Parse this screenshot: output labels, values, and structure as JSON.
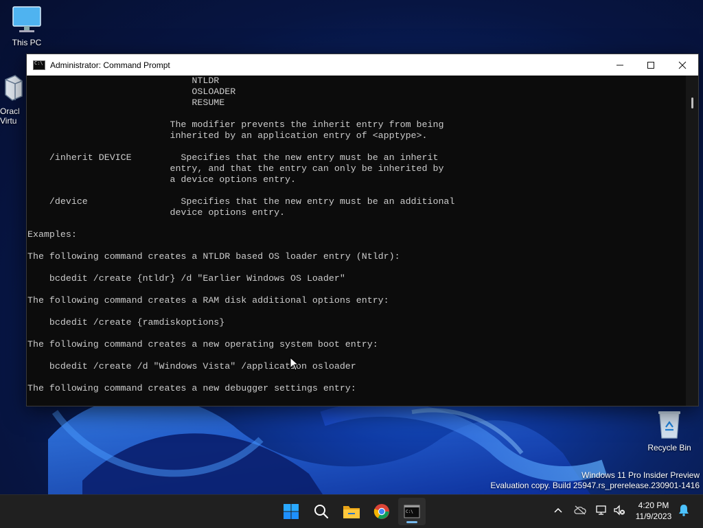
{
  "desktop": {
    "icons": [
      {
        "label": "This PC"
      },
      {
        "label": "Oracl\nVirtu"
      },
      {
        "label": "Recycle Bin"
      }
    ],
    "watermark": {
      "line1": "Windows 11 Pro Insider Preview",
      "line2": "Evaluation copy. Build 25947.rs_prerelease.230901-1416"
    }
  },
  "window": {
    "title": "Administrator: Command Prompt",
    "controls": {
      "minimize": "─",
      "maximize": "☐",
      "close": "✕"
    },
    "console_lines": [
      "                              NTLDR",
      "                              OSLOADER",
      "                              RESUME",
      "",
      "                          The modifier prevents the inherit entry from being",
      "                          inherited by an application entry of <apptype>.",
      "",
      "    /inherit DEVICE         Specifies that the new entry must be an inherit",
      "                          entry, and that the entry can only be inherited by",
      "                          a device options entry.",
      "",
      "    /device                 Specifies that the new entry must be an additional",
      "                          device options entry.",
      "",
      "Examples:",
      "",
      "The following command creates a NTLDR based OS loader entry (Ntldr):",
      "",
      "    bcdedit /create {ntldr} /d \"Earlier Windows OS Loader\"",
      "",
      "The following command creates a RAM disk additional options entry:",
      "",
      "    bcdedit /create {ramdiskoptions}",
      "",
      "The following command creates a new operating system boot entry:",
      "",
      "    bcdedit /create /d \"Windows Vista\" /application osloader",
      "",
      "The following command creates a new debugger settings entry:"
    ]
  },
  "taskbar": {
    "apps": [
      {
        "name": "start",
        "icon": "windows-logo-icon"
      },
      {
        "name": "search",
        "icon": "search-icon"
      },
      {
        "name": "file-explorer",
        "icon": "folder-icon"
      },
      {
        "name": "chrome",
        "icon": "chrome-icon"
      },
      {
        "name": "terminal",
        "icon": "terminal-icon",
        "active": true
      }
    ],
    "clock": {
      "time": "4:20 PM",
      "date": "11/9/2023"
    }
  },
  "colors": {
    "console_bg": "#0c0c0c",
    "console_fg": "#cccccc",
    "taskbar_bg": "#202020",
    "accent": "#76b9ed"
  }
}
